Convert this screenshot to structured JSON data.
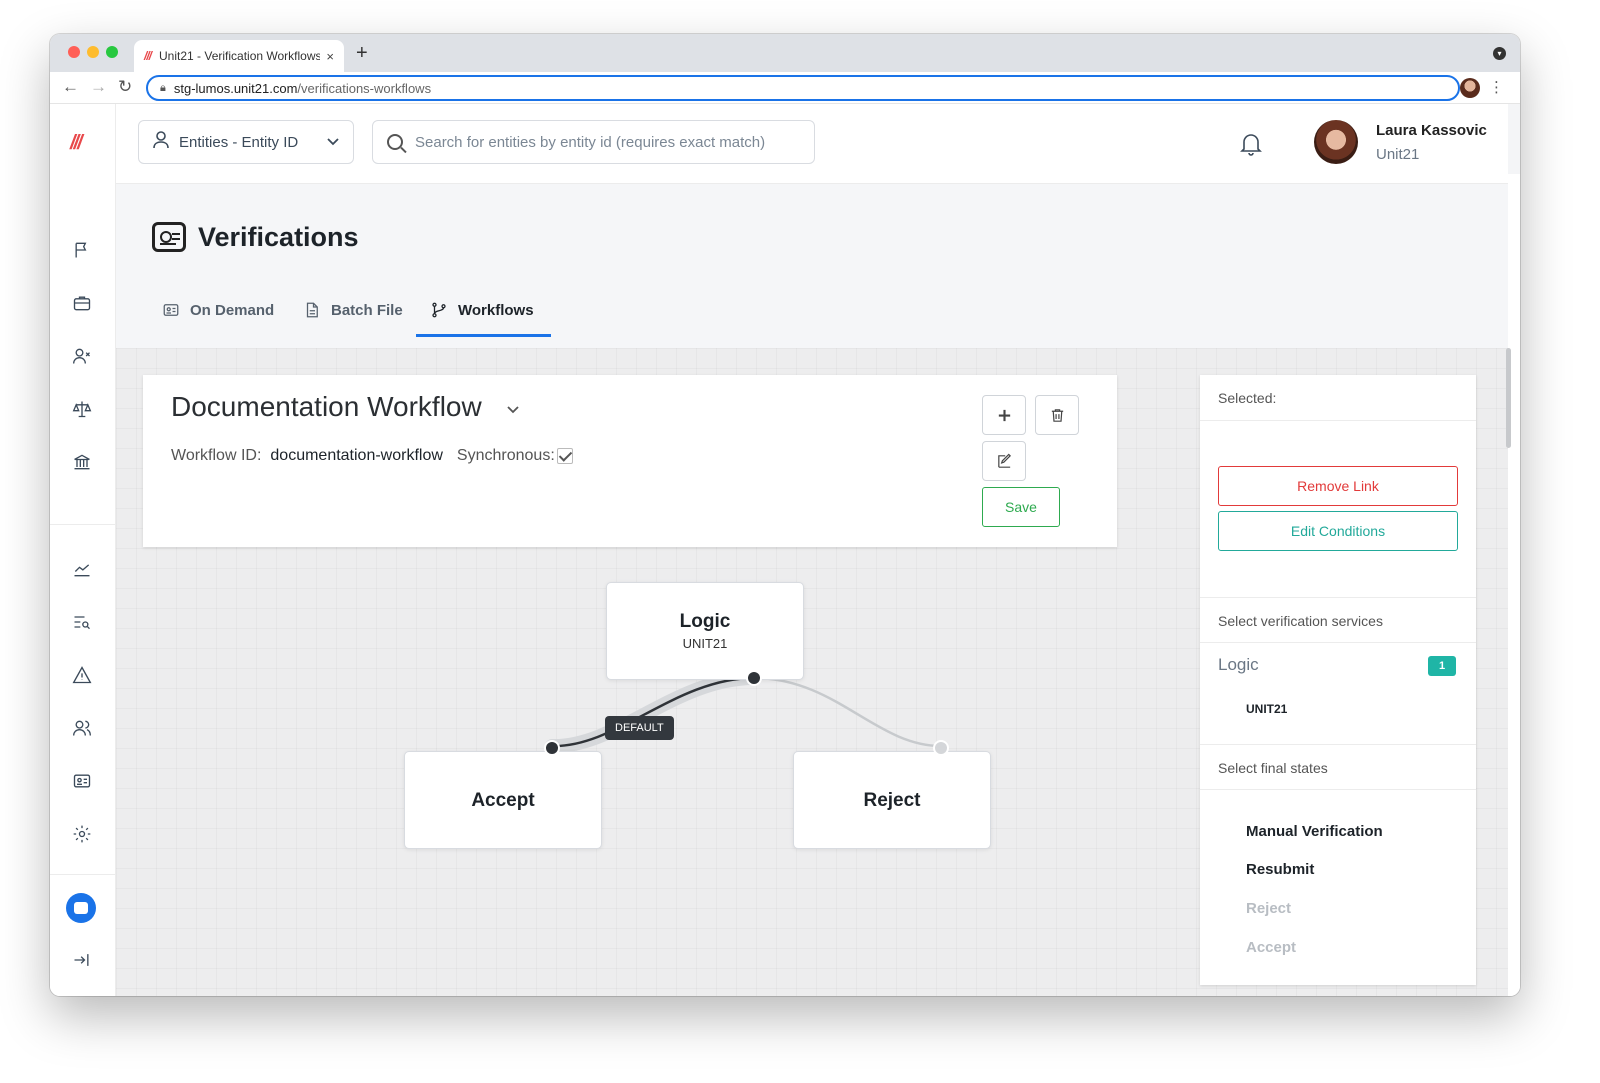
{
  "browser": {
    "tab_title": "Unit21 - Verification Workflows",
    "tab_favicon": "///",
    "tab_close": "×",
    "new_tab": "+",
    "url_host": "stg-lumos.unit21.com",
    "url_path": "/verifications-workflows"
  },
  "header": {
    "entity_select_label": "Entities - Entity ID",
    "search_placeholder": "Search for entities by entity id (requires exact match)",
    "user_name": "Laura Kassovic",
    "user_org": "Unit21"
  },
  "sidebar": {
    "logo": "///",
    "items": [
      {
        "icon": "flag-icon"
      },
      {
        "icon": "briefcase-icon"
      },
      {
        "icon": "user-x-icon"
      },
      {
        "icon": "scale-icon"
      },
      {
        "icon": "bank-icon"
      },
      {
        "icon": "chart-line-icon"
      },
      {
        "icon": "list-search-icon"
      },
      {
        "icon": "alert-triangle-icon"
      },
      {
        "icon": "users-icon"
      },
      {
        "icon": "id-card-icon"
      },
      {
        "icon": "gear-icon"
      }
    ]
  },
  "page": {
    "title": "Verifications",
    "tabs": [
      {
        "label": "On Demand"
      },
      {
        "label": "Batch File"
      },
      {
        "label": "Workflows"
      }
    ]
  },
  "workflow": {
    "name": "Documentation Workflow",
    "id_label": "Workflow ID:",
    "id_value": "documentation-workflow",
    "sync_label": "Synchronous:",
    "synchronous": true,
    "save_label": "Save"
  },
  "graph": {
    "nodes": [
      {
        "label": "Logic",
        "sub": "UNIT21"
      },
      {
        "label": "Accept"
      },
      {
        "label": "Reject"
      }
    ],
    "edge_badge": "DEFAULT"
  },
  "panel": {
    "selected_label": "Selected:",
    "remove_link": "Remove Link",
    "edit_conditions": "Edit Conditions",
    "services_header": "Select verification services",
    "service_name": "Logic",
    "service_count": "1",
    "service_item": "UNIT21",
    "final_states_header": "Select final states",
    "final_states": [
      {
        "label": "Manual Verification",
        "enabled": true
      },
      {
        "label": "Resubmit",
        "enabled": true
      },
      {
        "label": "Reject",
        "enabled": false
      },
      {
        "label": "Accept",
        "enabled": false
      }
    ]
  },
  "colors": {
    "accent": "#1a73e8",
    "danger": "#e23a3a",
    "teal": "#22a99a",
    "success": "#2eaa4f",
    "brand": "#e8484b"
  }
}
